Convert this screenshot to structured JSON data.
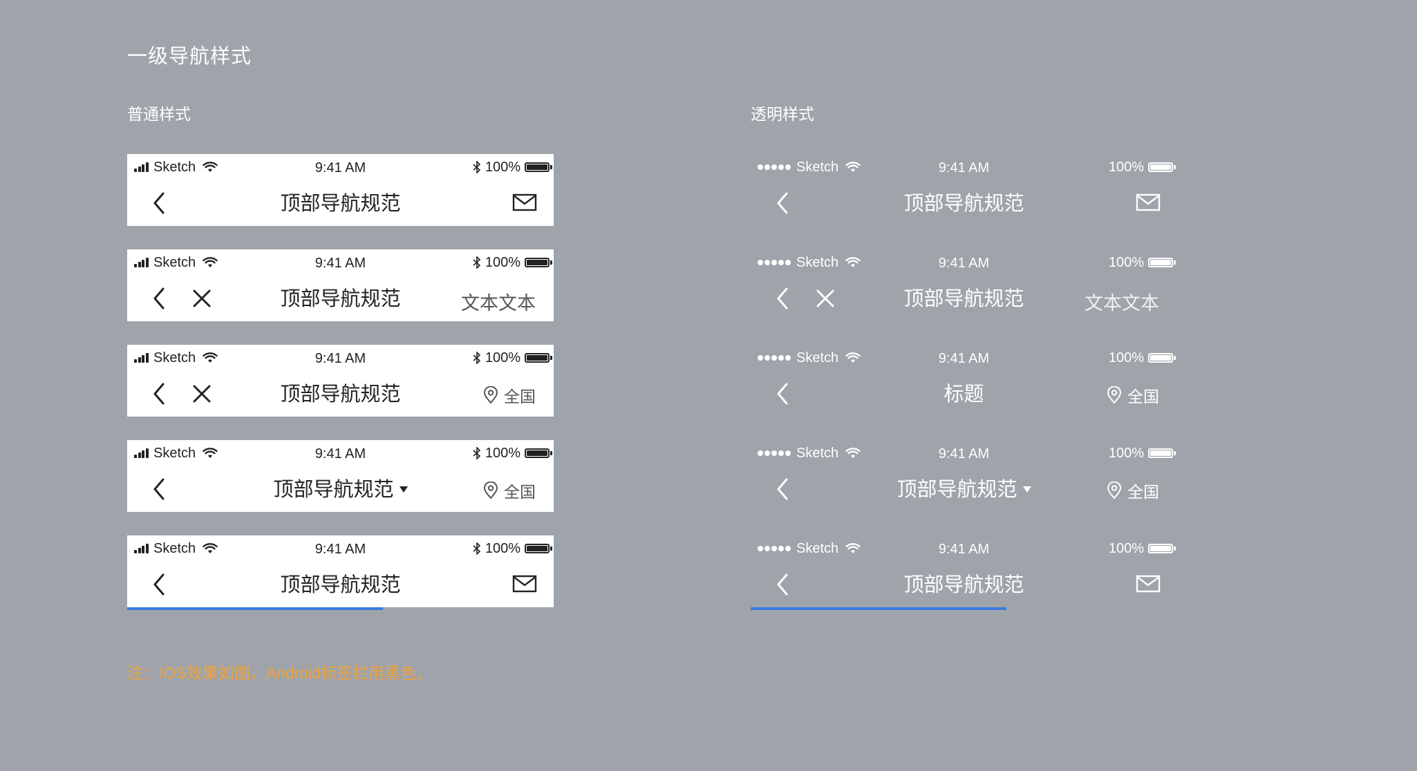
{
  "page_title": "一级导航样式",
  "accent_color": "#3a7bde",
  "note_color": "#f0a13a",
  "sections": {
    "normal_title": "普通样式",
    "transparent_title": "透明样式"
  },
  "status": {
    "carrier": "Sketch",
    "time": "9:41 AM",
    "battery": "100%",
    "wifi_icon": "wifi-icon",
    "bluetooth_icon": "bluetooth-icon",
    "battery_icon": "battery-icon"
  },
  "normal_bars": [
    {
      "title": "顶部导航规范",
      "right": "mail"
    },
    {
      "title": "顶部导航规范",
      "right_text": "文本文本"
    },
    {
      "title": "顶部导航规范",
      "location": "全国"
    },
    {
      "title": "顶部导航规范",
      "location": "全国"
    },
    {
      "title": "顶部导航规范",
      "right": "mail",
      "progress": 0.6
    }
  ],
  "transparent_bars": [
    {
      "title": "顶部导航规范",
      "right": "mail"
    },
    {
      "title": "顶部导航规范",
      "right_text": "文本文本"
    },
    {
      "title": "标题",
      "location": "全国"
    },
    {
      "title": "顶部导航规范",
      "location": "全国"
    },
    {
      "title": "顶部导航规范",
      "right": "mail",
      "progress": 0.6
    }
  ],
  "note": "注：IOS效果如图，Android标签栏用黑色。"
}
